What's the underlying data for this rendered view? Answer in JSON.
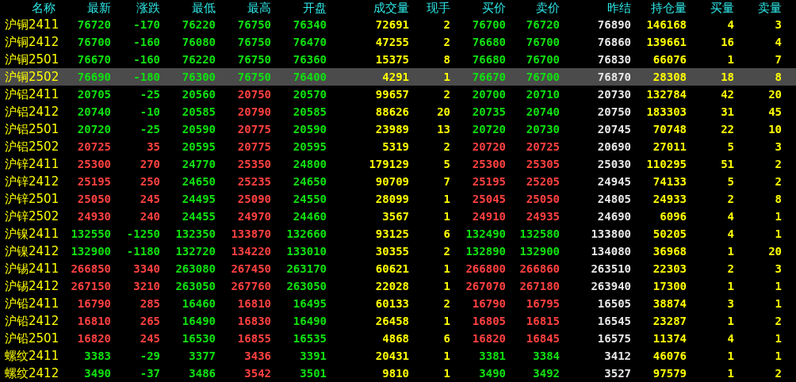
{
  "table": {
    "columns": [
      "名称",
      "最新",
      "涨跌",
      "最低",
      "最高",
      "开盘",
      "成交量",
      "现手",
      "买价",
      "卖价",
      "昨结",
      "持仓量",
      "买量",
      "卖量"
    ],
    "rows": [
      {
        "name": "沪铜2411",
        "last": "76720",
        "change": "-170",
        "low": "76220",
        "high": "76750",
        "open": "76340",
        "volume": "72691",
        "last_qty": "2",
        "bid": "76700",
        "ask": "76720",
        "prev_settle": "76890",
        "open_interest": "146168",
        "bid_qty": "4",
        "ask_qty": "3",
        "selected": false
      },
      {
        "name": "沪铜2412",
        "last": "76700",
        "change": "-160",
        "low": "76080",
        "high": "76750",
        "open": "76470",
        "volume": "47255",
        "last_qty": "2",
        "bid": "76680",
        "ask": "76700",
        "prev_settle": "76860",
        "open_interest": "139661",
        "bid_qty": "16",
        "ask_qty": "4",
        "selected": false
      },
      {
        "name": "沪铜2501",
        "last": "76670",
        "change": "-160",
        "low": "76220",
        "high": "76750",
        "open": "76360",
        "volume": "15375",
        "last_qty": "8",
        "bid": "76680",
        "ask": "76700",
        "prev_settle": "76830",
        "open_interest": "66076",
        "bid_qty": "1",
        "ask_qty": "7",
        "selected": false
      },
      {
        "name": "沪铜2502",
        "last": "76690",
        "change": "-180",
        "low": "76300",
        "high": "76750",
        "open": "76400",
        "volume": "4291",
        "last_qty": "1",
        "bid": "76670",
        "ask": "76700",
        "prev_settle": "76870",
        "open_interest": "28308",
        "bid_qty": "18",
        "ask_qty": "8",
        "selected": true
      },
      {
        "name": "沪铝2411",
        "last": "20705",
        "change": "-25",
        "low": "20560",
        "high": "20750",
        "open": "20570",
        "volume": "99657",
        "last_qty": "2",
        "bid": "20700",
        "ask": "20710",
        "prev_settle": "20730",
        "open_interest": "132784",
        "bid_qty": "42",
        "ask_qty": "20",
        "selected": false
      },
      {
        "name": "沪铝2412",
        "last": "20740",
        "change": "-10",
        "low": "20585",
        "high": "20790",
        "open": "20585",
        "volume": "88626",
        "last_qty": "20",
        "bid": "20735",
        "ask": "20740",
        "prev_settle": "20750",
        "open_interest": "183303",
        "bid_qty": "31",
        "ask_qty": "45",
        "selected": false
      },
      {
        "name": "沪铝2501",
        "last": "20720",
        "change": "-25",
        "low": "20590",
        "high": "20775",
        "open": "20590",
        "volume": "23989",
        "last_qty": "13",
        "bid": "20720",
        "ask": "20730",
        "prev_settle": "20745",
        "open_interest": "70748",
        "bid_qty": "22",
        "ask_qty": "10",
        "selected": false
      },
      {
        "name": "沪铝2502",
        "last": "20725",
        "change": "35",
        "low": "20595",
        "high": "20775",
        "open": "20595",
        "volume": "5319",
        "last_qty": "2",
        "bid": "20720",
        "ask": "20725",
        "prev_settle": "20690",
        "open_interest": "27011",
        "bid_qty": "5",
        "ask_qty": "3",
        "selected": false
      },
      {
        "name": "沪锌2411",
        "last": "25300",
        "change": "270",
        "low": "24770",
        "high": "25350",
        "open": "24800",
        "volume": "179129",
        "last_qty": "5",
        "bid": "25300",
        "ask": "25305",
        "prev_settle": "25030",
        "open_interest": "110295",
        "bid_qty": "51",
        "ask_qty": "2",
        "selected": false
      },
      {
        "name": "沪锌2412",
        "last": "25195",
        "change": "250",
        "low": "24650",
        "high": "25235",
        "open": "24650",
        "volume": "90709",
        "last_qty": "7",
        "bid": "25195",
        "ask": "25205",
        "prev_settle": "24945",
        "open_interest": "74133",
        "bid_qty": "5",
        "ask_qty": "2",
        "selected": false
      },
      {
        "name": "沪锌2501",
        "last": "25050",
        "change": "245",
        "low": "24495",
        "high": "25090",
        "open": "24550",
        "volume": "28099",
        "last_qty": "1",
        "bid": "25045",
        "ask": "25050",
        "prev_settle": "24805",
        "open_interest": "24933",
        "bid_qty": "2",
        "ask_qty": "8",
        "selected": false
      },
      {
        "name": "沪锌2502",
        "last": "24930",
        "change": "240",
        "low": "24455",
        "high": "24970",
        "open": "24460",
        "volume": "3567",
        "last_qty": "1",
        "bid": "24910",
        "ask": "24935",
        "prev_settle": "24690",
        "open_interest": "6096",
        "bid_qty": "4",
        "ask_qty": "1",
        "selected": false
      },
      {
        "name": "沪镍2411",
        "last": "132550",
        "change": "-1250",
        "low": "132350",
        "high": "133870",
        "open": "132660",
        "volume": "93125",
        "last_qty": "6",
        "bid": "132490",
        "ask": "132580",
        "prev_settle": "133800",
        "open_interest": "50205",
        "bid_qty": "4",
        "ask_qty": "1",
        "selected": false
      },
      {
        "name": "沪镍2412",
        "last": "132900",
        "change": "-1180",
        "low": "132720",
        "high": "134220",
        "open": "133010",
        "volume": "30355",
        "last_qty": "2",
        "bid": "132890",
        "ask": "132900",
        "prev_settle": "134080",
        "open_interest": "36968",
        "bid_qty": "1",
        "ask_qty": "20",
        "selected": false
      },
      {
        "name": "沪锡2411",
        "last": "266850",
        "change": "3340",
        "low": "263080",
        "high": "267450",
        "open": "263170",
        "volume": "60621",
        "last_qty": "1",
        "bid": "266800",
        "ask": "266860",
        "prev_settle": "263510",
        "open_interest": "22303",
        "bid_qty": "2",
        "ask_qty": "3",
        "selected": false
      },
      {
        "name": "沪锡2412",
        "last": "267150",
        "change": "3210",
        "low": "263050",
        "high": "267760",
        "open": "263050",
        "volume": "22028",
        "last_qty": "1",
        "bid": "267070",
        "ask": "267180",
        "prev_settle": "263940",
        "open_interest": "17300",
        "bid_qty": "1",
        "ask_qty": "1",
        "selected": false
      },
      {
        "name": "沪铅2411",
        "last": "16790",
        "change": "285",
        "low": "16460",
        "high": "16810",
        "open": "16495",
        "volume": "60133",
        "last_qty": "2",
        "bid": "16790",
        "ask": "16795",
        "prev_settle": "16505",
        "open_interest": "38874",
        "bid_qty": "3",
        "ask_qty": "1",
        "selected": false
      },
      {
        "name": "沪铅2412",
        "last": "16810",
        "change": "265",
        "low": "16490",
        "high": "16830",
        "open": "16490",
        "volume": "26458",
        "last_qty": "1",
        "bid": "16805",
        "ask": "16815",
        "prev_settle": "16545",
        "open_interest": "23287",
        "bid_qty": "1",
        "ask_qty": "2",
        "selected": false
      },
      {
        "name": "沪铅2501",
        "last": "16820",
        "change": "245",
        "low": "16530",
        "high": "16855",
        "open": "16535",
        "volume": "4868",
        "last_qty": "6",
        "bid": "16820",
        "ask": "16845",
        "prev_settle": "16575",
        "open_interest": "11374",
        "bid_qty": "4",
        "ask_qty": "1",
        "selected": false
      },
      {
        "name": "螺纹2411",
        "last": "3383",
        "change": "-29",
        "low": "3377",
        "high": "3436",
        "open": "3391",
        "volume": "20431",
        "last_qty": "1",
        "bid": "3381",
        "ask": "3384",
        "prev_settle": "3412",
        "open_interest": "46076",
        "bid_qty": "1",
        "ask_qty": "1",
        "selected": false
      },
      {
        "name": "螺纹2412",
        "last": "3490",
        "change": "-37",
        "low": "3486",
        "high": "3542",
        "open": "3501",
        "volume": "9810",
        "last_qty": "1",
        "bid": "3490",
        "ask": "3492",
        "prev_settle": "3527",
        "open_interest": "97579",
        "bid_qty": "1",
        "ask_qty": "2",
        "selected": false
      }
    ]
  }
}
